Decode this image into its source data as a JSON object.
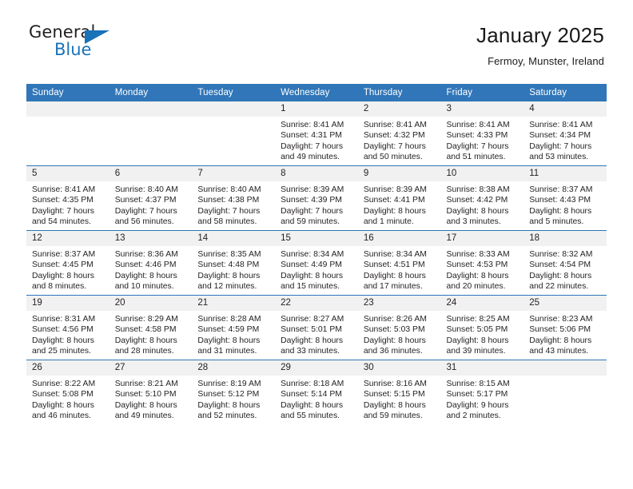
{
  "brand": {
    "name_top": "General",
    "name_bottom": "Blue"
  },
  "header": {
    "title": "January 2025",
    "subtitle": "Fermoy, Munster, Ireland"
  },
  "colors": {
    "header_blue": "#3076b8",
    "brand_blue": "#1a72b8",
    "daynum_bg": "#f1f1f1",
    "text": "#231f20"
  },
  "calendar": {
    "weekday_headers": [
      "Sunday",
      "Monday",
      "Tuesday",
      "Wednesday",
      "Thursday",
      "Friday",
      "Saturday"
    ],
    "weeks": [
      [
        {
          "day": "",
          "blank": true
        },
        {
          "day": "",
          "blank": true
        },
        {
          "day": "",
          "blank": true
        },
        {
          "day": "1",
          "sunrise": "Sunrise: 8:41 AM",
          "sunset": "Sunset: 4:31 PM",
          "daylight_1": "Daylight: 7 hours",
          "daylight_2": "and 49 minutes."
        },
        {
          "day": "2",
          "sunrise": "Sunrise: 8:41 AM",
          "sunset": "Sunset: 4:32 PM",
          "daylight_1": "Daylight: 7 hours",
          "daylight_2": "and 50 minutes."
        },
        {
          "day": "3",
          "sunrise": "Sunrise: 8:41 AM",
          "sunset": "Sunset: 4:33 PM",
          "daylight_1": "Daylight: 7 hours",
          "daylight_2": "and 51 minutes."
        },
        {
          "day": "4",
          "sunrise": "Sunrise: 8:41 AM",
          "sunset": "Sunset: 4:34 PM",
          "daylight_1": "Daylight: 7 hours",
          "daylight_2": "and 53 minutes."
        }
      ],
      [
        {
          "day": "5",
          "sunrise": "Sunrise: 8:41 AM",
          "sunset": "Sunset: 4:35 PM",
          "daylight_1": "Daylight: 7 hours",
          "daylight_2": "and 54 minutes."
        },
        {
          "day": "6",
          "sunrise": "Sunrise: 8:40 AM",
          "sunset": "Sunset: 4:37 PM",
          "daylight_1": "Daylight: 7 hours",
          "daylight_2": "and 56 minutes."
        },
        {
          "day": "7",
          "sunrise": "Sunrise: 8:40 AM",
          "sunset": "Sunset: 4:38 PM",
          "daylight_1": "Daylight: 7 hours",
          "daylight_2": "and 58 minutes."
        },
        {
          "day": "8",
          "sunrise": "Sunrise: 8:39 AM",
          "sunset": "Sunset: 4:39 PM",
          "daylight_1": "Daylight: 7 hours",
          "daylight_2": "and 59 minutes."
        },
        {
          "day": "9",
          "sunrise": "Sunrise: 8:39 AM",
          "sunset": "Sunset: 4:41 PM",
          "daylight_1": "Daylight: 8 hours",
          "daylight_2": "and 1 minute."
        },
        {
          "day": "10",
          "sunrise": "Sunrise: 8:38 AM",
          "sunset": "Sunset: 4:42 PM",
          "daylight_1": "Daylight: 8 hours",
          "daylight_2": "and 3 minutes."
        },
        {
          "day": "11",
          "sunrise": "Sunrise: 8:37 AM",
          "sunset": "Sunset: 4:43 PM",
          "daylight_1": "Daylight: 8 hours",
          "daylight_2": "and 5 minutes."
        }
      ],
      [
        {
          "day": "12",
          "sunrise": "Sunrise: 8:37 AM",
          "sunset": "Sunset: 4:45 PM",
          "daylight_1": "Daylight: 8 hours",
          "daylight_2": "and 8 minutes."
        },
        {
          "day": "13",
          "sunrise": "Sunrise: 8:36 AM",
          "sunset": "Sunset: 4:46 PM",
          "daylight_1": "Daylight: 8 hours",
          "daylight_2": "and 10 minutes."
        },
        {
          "day": "14",
          "sunrise": "Sunrise: 8:35 AM",
          "sunset": "Sunset: 4:48 PM",
          "daylight_1": "Daylight: 8 hours",
          "daylight_2": "and 12 minutes."
        },
        {
          "day": "15",
          "sunrise": "Sunrise: 8:34 AM",
          "sunset": "Sunset: 4:49 PM",
          "daylight_1": "Daylight: 8 hours",
          "daylight_2": "and 15 minutes."
        },
        {
          "day": "16",
          "sunrise": "Sunrise: 8:34 AM",
          "sunset": "Sunset: 4:51 PM",
          "daylight_1": "Daylight: 8 hours",
          "daylight_2": "and 17 minutes."
        },
        {
          "day": "17",
          "sunrise": "Sunrise: 8:33 AM",
          "sunset": "Sunset: 4:53 PM",
          "daylight_1": "Daylight: 8 hours",
          "daylight_2": "and 20 minutes."
        },
        {
          "day": "18",
          "sunrise": "Sunrise: 8:32 AM",
          "sunset": "Sunset: 4:54 PM",
          "daylight_1": "Daylight: 8 hours",
          "daylight_2": "and 22 minutes."
        }
      ],
      [
        {
          "day": "19",
          "sunrise": "Sunrise: 8:31 AM",
          "sunset": "Sunset: 4:56 PM",
          "daylight_1": "Daylight: 8 hours",
          "daylight_2": "and 25 minutes."
        },
        {
          "day": "20",
          "sunrise": "Sunrise: 8:29 AM",
          "sunset": "Sunset: 4:58 PM",
          "daylight_1": "Daylight: 8 hours",
          "daylight_2": "and 28 minutes."
        },
        {
          "day": "21",
          "sunrise": "Sunrise: 8:28 AM",
          "sunset": "Sunset: 4:59 PM",
          "daylight_1": "Daylight: 8 hours",
          "daylight_2": "and 31 minutes."
        },
        {
          "day": "22",
          "sunrise": "Sunrise: 8:27 AM",
          "sunset": "Sunset: 5:01 PM",
          "daylight_1": "Daylight: 8 hours",
          "daylight_2": "and 33 minutes."
        },
        {
          "day": "23",
          "sunrise": "Sunrise: 8:26 AM",
          "sunset": "Sunset: 5:03 PM",
          "daylight_1": "Daylight: 8 hours",
          "daylight_2": "and 36 minutes."
        },
        {
          "day": "24",
          "sunrise": "Sunrise: 8:25 AM",
          "sunset": "Sunset: 5:05 PM",
          "daylight_1": "Daylight: 8 hours",
          "daylight_2": "and 39 minutes."
        },
        {
          "day": "25",
          "sunrise": "Sunrise: 8:23 AM",
          "sunset": "Sunset: 5:06 PM",
          "daylight_1": "Daylight: 8 hours",
          "daylight_2": "and 43 minutes."
        }
      ],
      [
        {
          "day": "26",
          "sunrise": "Sunrise: 8:22 AM",
          "sunset": "Sunset: 5:08 PM",
          "daylight_1": "Daylight: 8 hours",
          "daylight_2": "and 46 minutes."
        },
        {
          "day": "27",
          "sunrise": "Sunrise: 8:21 AM",
          "sunset": "Sunset: 5:10 PM",
          "daylight_1": "Daylight: 8 hours",
          "daylight_2": "and 49 minutes."
        },
        {
          "day": "28",
          "sunrise": "Sunrise: 8:19 AM",
          "sunset": "Sunset: 5:12 PM",
          "daylight_1": "Daylight: 8 hours",
          "daylight_2": "and 52 minutes."
        },
        {
          "day": "29",
          "sunrise": "Sunrise: 8:18 AM",
          "sunset": "Sunset: 5:14 PM",
          "daylight_1": "Daylight: 8 hours",
          "daylight_2": "and 55 minutes."
        },
        {
          "day": "30",
          "sunrise": "Sunrise: 8:16 AM",
          "sunset": "Sunset: 5:15 PM",
          "daylight_1": "Daylight: 8 hours",
          "daylight_2": "and 59 minutes."
        },
        {
          "day": "31",
          "sunrise": "Sunrise: 8:15 AM",
          "sunset": "Sunset: 5:17 PM",
          "daylight_1": "Daylight: 9 hours",
          "daylight_2": "and 2 minutes."
        },
        {
          "day": "",
          "blank": true
        }
      ]
    ]
  }
}
